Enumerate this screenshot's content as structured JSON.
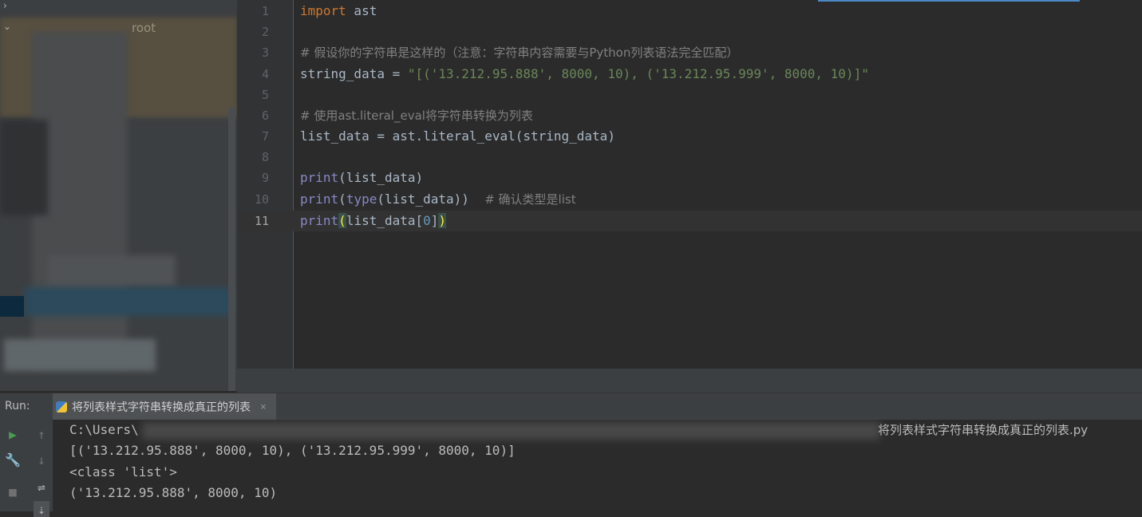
{
  "project": {
    "root_label": "root"
  },
  "editor": {
    "line_numbers": [
      "1",
      "2",
      "3",
      "4",
      "5",
      "6",
      "7",
      "8",
      "9",
      "10",
      "11"
    ],
    "current_line": "11",
    "lines": {
      "l1_kw": "import",
      "l1_rest": " ast",
      "l3": "# 假设你的字符串是这样的（注意：字符串内容需要与Python列表语法完全匹配）",
      "l4_var": "string_data = ",
      "l4_str": "\"[('13.212.95.888', 8000, 10), ('13.212.95.999', 8000, 10)]\"",
      "l6": "# 使用ast.literal_eval将字符串转换为列表",
      "l7": "list_data = ast.literal_eval(string_data)",
      "l9_fn": "print",
      "l9_rest": "(list_data)",
      "l10_fn": "print",
      "l10_mid": "(",
      "l10_fn2": "type",
      "l10_rest": "(list_data))  ",
      "l10_cm": "# 确认类型是list",
      "l11_fn": "print",
      "l11_open": "(",
      "l11_mid": "list_data[",
      "l11_num": "0",
      "l11_close_sq": "]",
      "l11_close": ")"
    }
  },
  "run": {
    "label": "Run:",
    "tab_name": "将列表样式字符串转换成真正的列表",
    "tab_close": "×",
    "output": {
      "cmd_prefix": "C:\\Users\\",
      "cmd_suffix": "将列表样式字符串转换成真正的列表.py",
      "line2": "[('13.212.95.888', 8000, 10), ('13.212.95.999', 8000, 10)]",
      "line3": "<class 'list'>",
      "line4": "('13.212.95.888', 8000, 10)"
    }
  },
  "colors": {
    "keyword": "#cc7832",
    "string": "#6a8759",
    "comment": "#808080",
    "builtin": "#8888c6",
    "number": "#6897bb",
    "run_green": "#499c54"
  }
}
